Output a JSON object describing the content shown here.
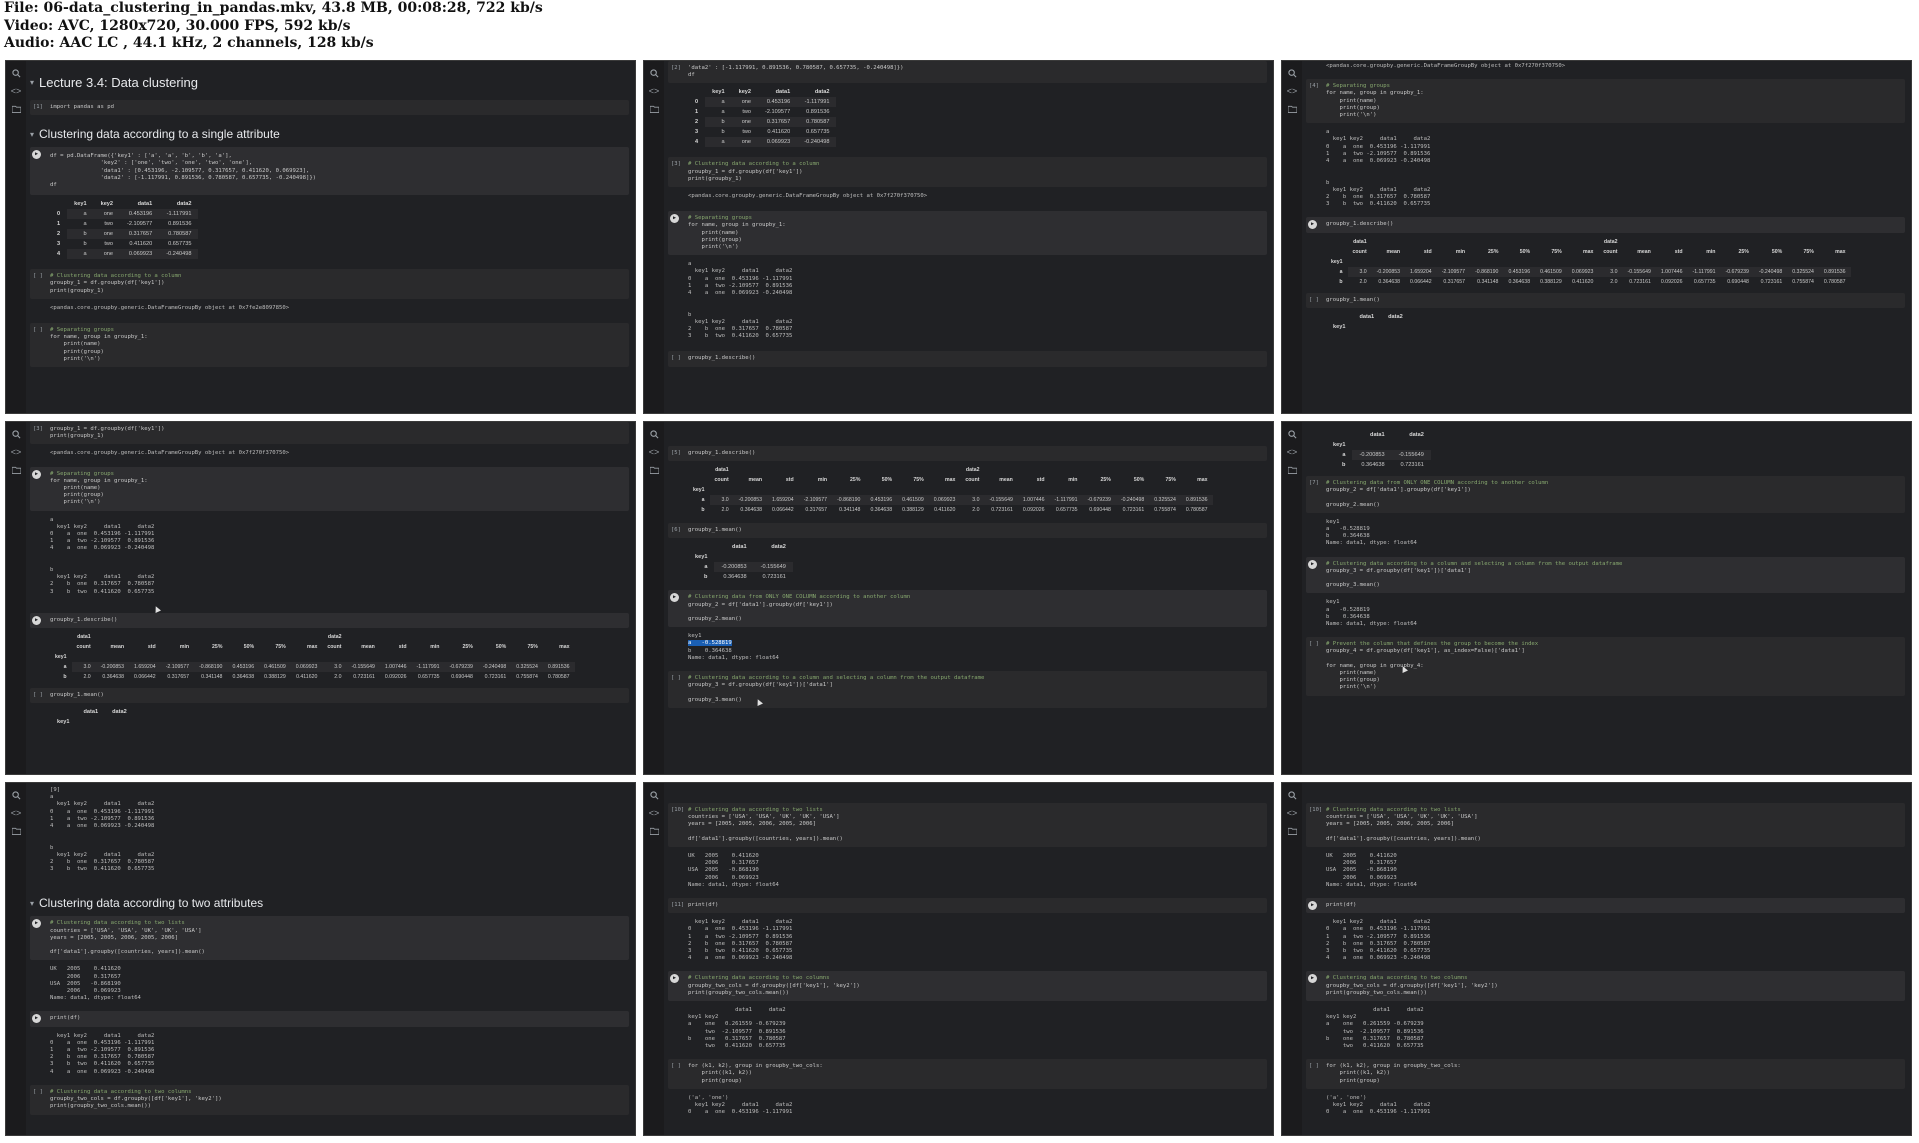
{
  "header": {
    "line1": "File: 06-data_clustering_in_pandas.mkv, 43.8 MB, 00:08:28, 722 kb/s",
    "line2": "Video: AVC, 1280x720, 30.000 FPS, 592 kb/s",
    "line3": "Audio: AAC LC , 44.1 kHz, 2 channels, 128 kb/s"
  },
  "lecture_title": "Lecture 3.4: Data clustering",
  "section_single": "Clustering data according to a single attribute",
  "section_two": "Clustering data according to two attributes",
  "code": {
    "import": "import pandas as pd",
    "df_create": "df = pd.DataFrame({'key1' : ['a', 'a', 'b', 'b', 'a'],\n               'key2' : ['one', 'two', 'one', 'two', 'one'],\n               'data1' : [0.453196, -2.109577, 0.317657, 0.411620, 0.069923],\n               'data2' : [-1.117991, 0.891536, 0.780587, 0.657735, -0.240498]})\ndf",
    "df_tail": "'data2' : [-1.117991, 0.891536, 0.780587, 0.657735, -0.240498]})\ndf",
    "group1_comment": "# Clustering data according to a column",
    "group1": "groupby_1 = df.groupby(df['key1'])\nprint(groupby_1)",
    "group1_out": "<pandas.core.groupby.generic.DataFrameGroupBy object at 0x7fe2e8097850>",
    "group1_out_b": "<pandas.core.groupby.generic.DataFrameGroupBy object at 0x7f270f370750>",
    "sep_comment": "# Separating groups",
    "sep": "for name, group in groupby_1:\n    print(name)\n    print(group)\n    print('\\n')",
    "sep_out": "a\n  key1 key2     data1     data2\n0    a  one  0.453196 -1.117991\n1    a  two -2.109577  0.891536\n4    a  one  0.069923 -0.240498\n\n\nb\n  key1 key2     data1     data2\n2    b  one  0.317657  0.780587\n3    b  two  0.411620  0.657735",
    "describe": "groupby_1.describe()",
    "mean": "groupby_1.mean()",
    "g2_comment": "# Clustering data from ONLY ONE COLUMN according to another column",
    "g2": "groupby_2 = df['data1'].groupby(df['key1'])\n\ngroupby_2.mean()",
    "g2_out_head": "key1",
    "g2_out_a": "a   -0.528819",
    "g2_out_b": "b    0.364638",
    "g2_out_tail": "Name: data1, dtype: float64",
    "g3_comment": "# Clustering data according to a column and selecting a column from the output dataframe",
    "g3": "groupby_3 = df.groupby(df['key1'])['data1']\n\ngroupby_3.mean()",
    "g4_comment": "# Prevent the column that defines the group to become the index",
    "g4": "groupby_4 = df.groupby(df['key1'], as_index=False)['data1']\n\nfor name, group in groupby_4:\n    print(name)\n    print(group)\n    print('\\n')",
    "two_lists_comment": "# Clustering data according to two lists",
    "two_lists": "countries = ['USA', 'USA', 'UK', 'UK', 'USA']\nyears = [2005, 2005, 2006, 2005, 2006]\n\ndf['data1'].groupby([countries, years]).mean()",
    "two_lists_out": "UK   2005    0.411620\n     2006    0.317657\nUSA  2005   -0.868190\n     2006    0.069923\nName: data1, dtype: float64",
    "print_df": "print(df)",
    "print_df_out": "  key1 key2     data1     data2\n0    a  one  0.453196 -1.117991\n1    a  two -2.109577  0.891536\n2    b  one  0.317657  0.780587\n3    b  two  0.411620  0.657735\n4    a  one  0.069923 -0.240498",
    "two_cols_comment": "# Clustering data according to two columns",
    "two_cols": "groupby_two_cols = df.groupby([df['key1'], 'key2'])\nprint(groupby_two_cols.mean())",
    "two_cols_out": "              data1     data2\nkey1 key2\na    one   0.261559 -0.679239\n     two  -2.109577  0.891536\nb    one   0.317657  0.780587\n     two   0.411620  0.657735",
    "loop2": "for (k1, k2), group in groupby_two_cols:\n    print((k1, k2))\n    print(group)",
    "loop2_out": "('a', 'one')\n  key1 key2     data1     data2\n0    a  one  0.453196 -1.117991"
  },
  "gutter": {
    "blank": "[ ]",
    "n1": "[1]",
    "n2": "[2]",
    "n3": "[3]",
    "n4": "[4]",
    "n5": "[5]",
    "n6": "[6]",
    "n7": "[7]",
    "n9": "[9]",
    "n10": "[10]",
    "n11": "[11]"
  },
  "df_table": {
    "headers": [
      "",
      "key1",
      "key2",
      "data1",
      "data2"
    ],
    "rows": [
      [
        "0",
        "a",
        "one",
        "0.453196",
        "-1.117991"
      ],
      [
        "1",
        "a",
        "two",
        "-2.109577",
        "0.891536"
      ],
      [
        "2",
        "b",
        "one",
        "0.317657",
        "0.780587"
      ],
      [
        "3",
        "b",
        "two",
        "0.411620",
        "0.657735"
      ],
      [
        "4",
        "a",
        "one",
        "0.069923",
        "-0.240498"
      ]
    ]
  },
  "describe_table": {
    "group_row": [
      "",
      "data1",
      "",
      "",
      "",
      "",
      "",
      "",
      "",
      "data2",
      "",
      "",
      "",
      "",
      "",
      "",
      ""
    ],
    "stat_row": [
      "",
      "count",
      "mean",
      "std",
      "min",
      "25%",
      "50%",
      "75%",
      "max",
      "count",
      "mean",
      "std",
      "min",
      "25%",
      "50%",
      "75%",
      "max"
    ],
    "index_name": "key1",
    "rows": [
      [
        "a",
        "3.0",
        "-0.200853",
        "1.659204",
        "-2.109577",
        "-0.868190",
        "0.453196",
        "0.461509",
        "0.069923",
        "3.0",
        "-0.155649",
        "1.007446",
        "-1.117991",
        "-0.679239",
        "-0.240498",
        "0.325524",
        "0.891536"
      ],
      [
        "b",
        "2.0",
        "0.364638",
        "0.066442",
        "0.317657",
        "0.341148",
        "0.364638",
        "0.388129",
        "0.411620",
        "2.0",
        "0.723161",
        "0.092026",
        "0.657735",
        "0.690448",
        "0.723161",
        "0.755874",
        "0.780587"
      ]
    ]
  },
  "mean_table": {
    "headers": [
      "",
      "data1",
      "data2"
    ],
    "index_name": "key1",
    "rows": [
      [
        "a",
        "-0.200853",
        "-0.155649"
      ],
      [
        "b",
        "0.364638",
        "0.723161"
      ]
    ]
  },
  "icons": {
    "search": "search-icon",
    "code": "code-icon",
    "folder": "folder-icon"
  }
}
